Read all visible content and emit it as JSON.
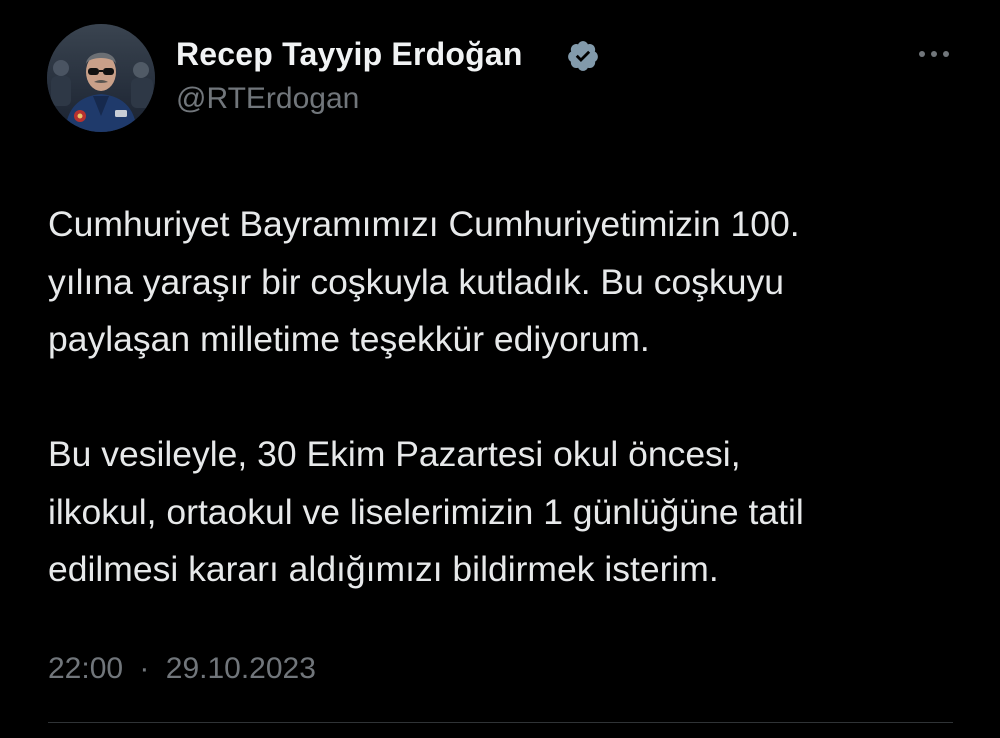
{
  "author": {
    "name": "Recep Tayyip Erdoğan",
    "handle": "@RTErdogan"
  },
  "icons": {
    "verified": "verified-badge-icon",
    "more": "more-options-icon",
    "avatar": "profile-avatar"
  },
  "tweet": {
    "paragraphs": [
      "Cumhuriyet Bayramımızı Cumhuriyetimizin 100.\nyılına yaraşır bir coşkuyla kutladık. Bu coşkuyu\npaylaşan milletime teşekkür ediyorum.",
      "Bu vesileyle, 30 Ekim Pazartesi okul öncesi,\nilkokul, ortaokul ve liselerimizin 1 günlüğüne tatil\nedilmesi kararı aldığımızı bildirmek isterim."
    ]
  },
  "meta": {
    "time": "22:00",
    "separator": "·",
    "date": "29.10.2023"
  },
  "colors": {
    "background": "#000000",
    "text": "#e7e9ea",
    "secondary": "#71767b",
    "divider": "#2f3336",
    "verified": "#829aab"
  }
}
